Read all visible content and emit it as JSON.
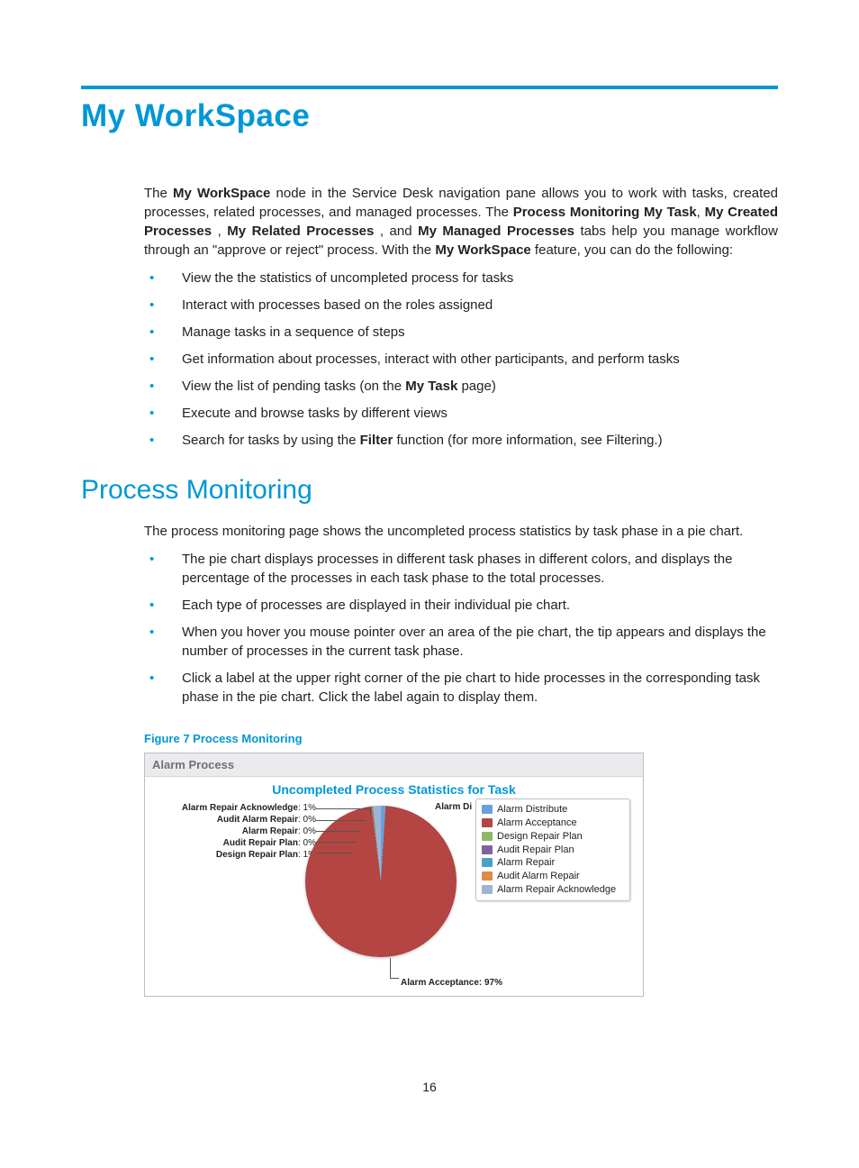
{
  "page_number": "16",
  "heading1": "My WorkSpace",
  "intro": {
    "pre": "The ",
    "b1": "My WorkSpace",
    "t1": " node in the Service Desk navigation pane allows you to work with tasks, created processes, related processes, and managed processes. The ",
    "b2": "Process Monitoring My Task",
    "t2": ", ",
    "b3": "My Created Processes",
    "t3": " , ",
    "b4": "My Related Processes",
    "t4": " , and ",
    "b5": "My Managed Processes",
    "t5": "  tabs help you manage workflow through an \"approve or reject\" process. With the ",
    "b6": "My WorkSpace",
    "t6": " feature, you can do the following:"
  },
  "list1": {
    "i0": "View the the statistics of uncompleted process for tasks",
    "i1": "Interact with processes based on the roles assigned",
    "i2": "Manage tasks in a sequence of steps",
    "i3": "Get information about processes, interact with other participants, and perform tasks",
    "i4_a": "View the list of pending tasks (on the ",
    "i4_b": "My Task",
    "i4_c": " page)",
    "i5": "Execute and browse tasks by different views",
    "i6_a": "Search for tasks by using the ",
    "i6_b": "Filter",
    "i6_c": " function (for more information, see Filtering.)"
  },
  "heading2": "Process Monitoring",
  "para2": "The process monitoring page shows the uncompleted process statistics by task phase in a pie chart.",
  "list2": {
    "i0": "The pie chart displays processes in different task phases in different colors, and displays the percentage of the processes in each task phase to the total processes.",
    "i1": "Each type of processes are displayed in their individual pie chart.",
    "i2": "When you hover you mouse pointer over an area of the pie chart, the tip appears and displays the number of processes in the current task phase.",
    "i3": "Click a label at the upper right corner of the pie chart to hide processes in the corresponding task phase in the pie chart. Click the label again to display them."
  },
  "figure_caption": "Figure 7 Process Monitoring",
  "chart": {
    "panel_title": "Alarm Process",
    "title": "Uncompleted Process Statistics for Task",
    "legend": {
      "l0": "Alarm Distribute",
      "l1": "Alarm Acceptance",
      "l2": "Design Repair Plan",
      "l3": "Audit Repair Plan",
      "l4": "Alarm Repair",
      "l5": "Audit Alarm Repair",
      "l6": "Alarm Repair Acknowledge"
    },
    "colors": {
      "c0": "#6aa0d8",
      "c1": "#b44543",
      "c2": "#8fb768",
      "c3": "#7e649e",
      "c4": "#4ca0c5",
      "c5": "#de8b46",
      "c6": "#9db5d4"
    },
    "callouts": {
      "left0_b": "Alarm Repair Acknowledge",
      "left0_v": ": 1%",
      "left1_b": "Audit Alarm Repair",
      "left1_v": ": 0%",
      "left2_b": "Alarm Repair",
      "left2_v": ": 0%",
      "left3_b": "Audit Repair Plan",
      "left3_v": ": 0%",
      "left4_b": "Design Repair Plan",
      "left4_v": ": 1%",
      "topright": "Alarm Di",
      "bottom_b": "Alarm Acceptance",
      "bottom_v": ": 97%"
    }
  },
  "chart_data": {
    "type": "pie",
    "title": "Uncompleted Process Statistics for Task",
    "series": [
      {
        "name": "Alarm Distribute",
        "value": 1,
        "color": "#6aa0d8"
      },
      {
        "name": "Alarm Acceptance",
        "value": 97,
        "color": "#b44543"
      },
      {
        "name": "Design Repair Plan",
        "value": 1,
        "color": "#8fb768"
      },
      {
        "name": "Audit Repair Plan",
        "value": 0,
        "color": "#7e649e"
      },
      {
        "name": "Alarm Repair",
        "value": 0,
        "color": "#4ca0c5"
      },
      {
        "name": "Audit Alarm Repair",
        "value": 0,
        "color": "#de8b46"
      },
      {
        "name": "Alarm Repair Acknowledge",
        "value": 1,
        "color": "#9db5d4"
      }
    ],
    "unit": "percent",
    "legend_position": "top-right"
  }
}
